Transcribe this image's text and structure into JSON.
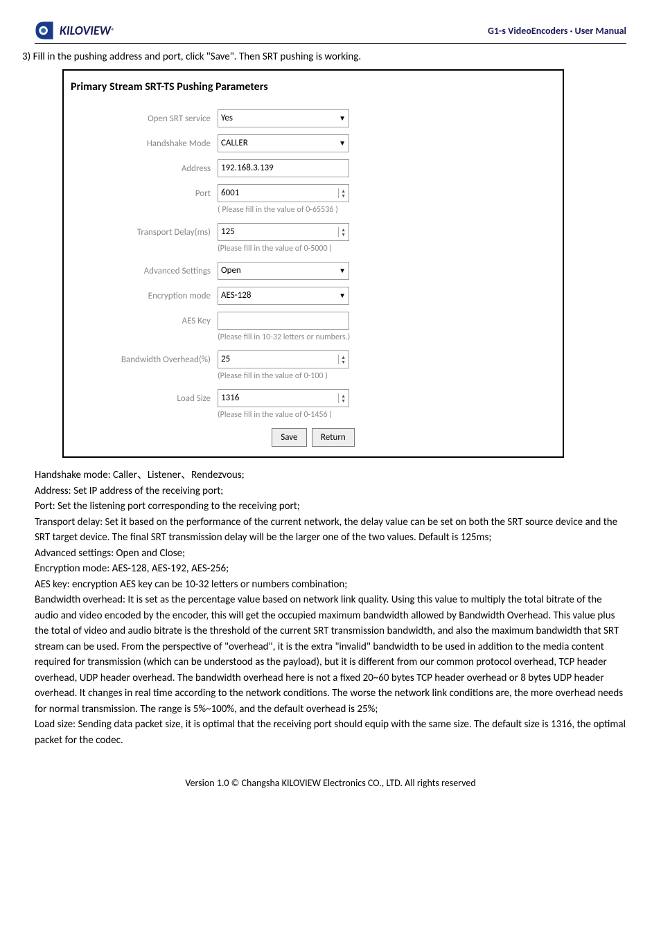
{
  "header": {
    "brand": "KILOVIEW",
    "reg": "®",
    "doc_title": "G1-s VideoEncoders · User Manual"
  },
  "step": {
    "num": "3)",
    "text": "Fill in the pushing address and port, click \"Save\". Then SRT pushing is working."
  },
  "panel": {
    "title": "Primary Stream SRT-TS Pushing Parameters",
    "fields": {
      "open_srt": {
        "label": "Open SRT service",
        "value": "Yes"
      },
      "handshake": {
        "label": "Handshake Mode",
        "value": "CALLER"
      },
      "address": {
        "label": "Address",
        "value": "192.168.3.139"
      },
      "port": {
        "label": "Port",
        "value": "6001",
        "hint": "( Please fill in the value of 0-65536 )"
      },
      "delay": {
        "label": "Transport Delay(ms)",
        "value": "125",
        "hint": "(Please fill in the value of 0-5000 )"
      },
      "advanced": {
        "label": "Advanced Settings",
        "value": "Open"
      },
      "encmode": {
        "label": "Encryption mode",
        "value": "AES-128"
      },
      "aeskey": {
        "label": "AES Key",
        "value": "",
        "hint": "(Please fill in 10-32 letters or numbers.)"
      },
      "bwoh": {
        "label": "Bandwidth Overhead(%)",
        "value": "25",
        "hint": "(Please fill in the value of 0-100 )"
      },
      "loadsize": {
        "label": "Load Size",
        "value": "1316",
        "hint": "(Please fill in the value of 0-1456 )"
      }
    },
    "buttons": {
      "save": "Save",
      "return": "Return"
    }
  },
  "body": {
    "p1": "Handshake mode: Caller、Listener、Rendezvous;",
    "p2": "Address: Set IP address of the receiving port;",
    "p3": "Port: Set the listening port corresponding to the receiving port;",
    "p4": "Transport delay: Set it based on the performance of the current network, the delay value can be set on both the SRT source device and the SRT target device. The final SRT transmission delay will be the larger one of the two values. Default is 125ms;",
    "p5": "Advanced settings: Open and Close;",
    "p6": "Encryption mode: AES-128, AES-192, AES-256;",
    "p7": "AES key: encryption AES key can be 10-32 letters or numbers combination;",
    "p8": "Bandwidth overhead: It is set as the percentage value based on network link quality. Using this value to multiply the total bitrate of the audio and video encoded by the encoder, this will get the occupied maximum bandwidth allowed by Bandwidth Overhead. This value plus the total of video and audio bitrate is the threshold of the current SRT transmission bandwidth, and also the maximum bandwidth that SRT stream can be used. From the perspective of \"overhead\", it is the extra \"invalid\" bandwidth to be used in addition to the media content required for transmission (which can be understood as the payload), but it is different from our common protocol overhead, TCP header overhead, UDP header overhead. The bandwidth overhead here is not a fixed 20~60 bytes TCP header overhead or 8 bytes UDP header overhead. It changes in real time according to the network conditions. The worse the network link conditions are, the more overhead needs for normal transmission. The range is 5%~100%, and the default overhead is 25%;",
    "p9": "Load size: Sending data packet size, it is optimal that the receiving port should equip with the same size. The default size is 1316, the optimal packet for the codec."
  },
  "footer": "Version 1.0 © Changsha KILOVIEW Electronics CO., LTD. All rights reserved"
}
